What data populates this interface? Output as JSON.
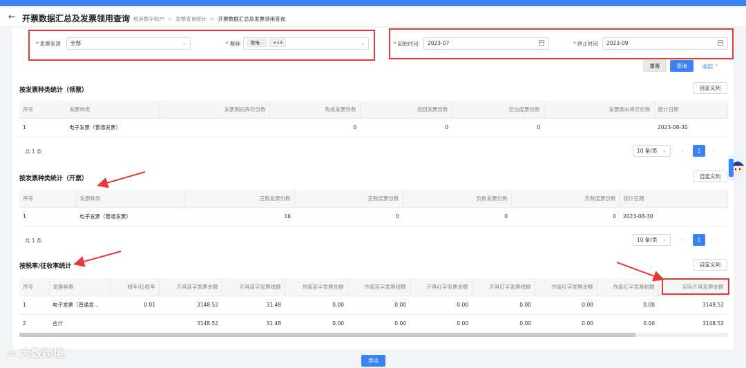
{
  "header": {
    "back_label": "←",
    "title": "开票数据汇总及发票领用查询",
    "breadcrumbs": [
      "税务数字账户",
      "发票查询统计",
      "开票数据汇总及发票领用查询"
    ],
    "breadcrumb_sep": ">"
  },
  "filters": {
    "source": {
      "label": "发票来源",
      "value": "全部"
    },
    "type": {
      "label": "票种",
      "tag": "数电...",
      "more": "+13"
    },
    "start": {
      "label": "起始时间",
      "value": "2023-07"
    },
    "end": {
      "label": "终止时间",
      "value": "2023-09"
    },
    "required_mark": "*"
  },
  "actions": {
    "reset": "重置",
    "search": "查询",
    "collapse": "收起"
  },
  "section1": {
    "title": "按发票种类统计（领票）",
    "custom_btn": "自定义列",
    "columns": [
      "序号",
      "发票种类",
      "发票期初库存份数",
      "购进发票份数",
      "退回发票份数",
      "空白废票份数",
      "发票期末库存份数",
      "统计日期"
    ],
    "rows": [
      [
        "1",
        "电子发票（普通发票）",
        "",
        "0",
        "0",
        "0",
        "",
        "2023-08-30"
      ]
    ],
    "total": "共 1 条",
    "page_size": "10 条/页",
    "page": "1"
  },
  "section2": {
    "title": "按发票种类统计（开票）",
    "custom_btn": "自定义列",
    "columns": [
      "序号",
      "发票种类",
      "正数发票份数",
      "正数废票份数",
      "负数发票份数",
      "负数废票份数",
      "统计日期"
    ],
    "rows": [
      [
        "1",
        "电子发票（普通发票）",
        "16",
        "0",
        "0",
        "0",
        "2023-08-30"
      ]
    ],
    "total": "共 1 条",
    "page_size": "10 条/页",
    "page": "1"
  },
  "section3": {
    "title": "按税率/征收率统计",
    "custom_btn": "自定义列",
    "columns": [
      "序号",
      "发票种类",
      "税率/征收率",
      "开具蓝字发票金额",
      "开具蓝字发票税额",
      "作废蓝字发票金额",
      "作废蓝字发票税额",
      "开具红字发票金额",
      "开具红字发票税额",
      "作废红字发票金额",
      "作废红字发票税额",
      "实际开具发票金额"
    ],
    "rows": [
      [
        "1",
        "电子发票（普通发...",
        "0.01",
        "3148.52",
        "31.48",
        "0.00",
        "0.00",
        "0.00",
        "0.00",
        "0.00",
        "0.00",
        "3148.52"
      ],
      [
        "2",
        "合计",
        "",
        "3148.52",
        "31.48",
        "0.00",
        "0.00",
        "0.00",
        "0.00",
        "0.00",
        "0.00",
        "3148.52"
      ]
    ]
  },
  "export_label": "导出",
  "watermark": "大数跨境",
  "accent_color": "#3b82f6",
  "annotation_color": "#e53935"
}
